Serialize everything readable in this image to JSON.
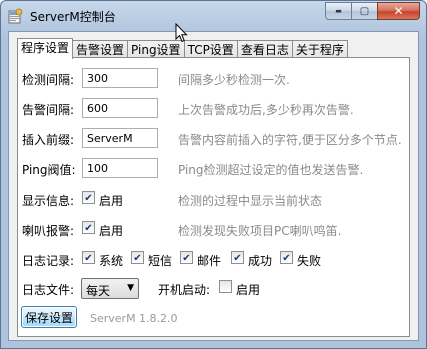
{
  "window": {
    "title": "ServerM控制台",
    "minimize_label": "▬",
    "maximize_label": "▢",
    "close_label": "✕"
  },
  "tabs": [
    {
      "label": "程序设置",
      "active": true
    },
    {
      "label": "告警设置",
      "active": false
    },
    {
      "label": "Ping设置",
      "active": false
    },
    {
      "label": "TCP设置",
      "active": false
    },
    {
      "label": "查看日志",
      "active": false
    },
    {
      "label": "关于程序",
      "active": false
    }
  ],
  "settings": {
    "interval": {
      "label": "检测间隔:",
      "value": "300",
      "hint": "间隔多少秒检测一次."
    },
    "alarm_interval": {
      "label": "告警间隔:",
      "value": "600",
      "hint": "上次告警成功后,多少秒再次告警."
    },
    "prefix": {
      "label": "插入前缀:",
      "value": "ServerM",
      "hint": "告警内容前插入的字符,便于区分多个节点."
    },
    "ping_threshold": {
      "label": "Ping阀值:",
      "value": "100",
      "hint": "Ping检测超过设定的值也发送告警."
    },
    "show_info": {
      "label": "显示信息:",
      "option": "启用",
      "checked": true,
      "hint": "检测的过程中显示当前状态"
    },
    "beep_alarm": {
      "label": "喇叭报警:",
      "option": "启用",
      "checked": true,
      "hint": "检测发现失败项目PC喇叭鸣笛."
    },
    "log_record": {
      "label": "日志记录:",
      "options": [
        {
          "label": "系统",
          "checked": true
        },
        {
          "label": "短信",
          "checked": true
        },
        {
          "label": "邮件",
          "checked": true
        },
        {
          "label": "成功",
          "checked": true
        },
        {
          "label": "失败",
          "checked": true
        }
      ]
    },
    "log_file": {
      "label": "日志文件:",
      "selected": "每天"
    },
    "autostart": {
      "label": "开机启动:",
      "option": "启用",
      "checked": false
    }
  },
  "footer": {
    "save_label": "保存设置",
    "version": "ServerM 1.8.2.0"
  }
}
